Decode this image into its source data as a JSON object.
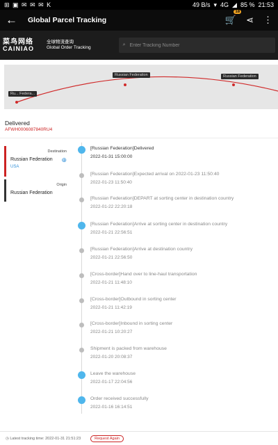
{
  "status_bar": {
    "left_icons": "⊞ ▣ ✉ ✉ ✉ K",
    "net_speed": "49 B/s",
    "signal": "4G",
    "battery": "85 %",
    "time": "21:53"
  },
  "app_bar": {
    "title": "Global Parcel Tracking",
    "cart_count": "18"
  },
  "brand": {
    "logo_cn": "菜鸟网络",
    "logo_en": "CAINIAO",
    "sub_cn": "全球物流查询",
    "sub_en": "Global Order Tracking",
    "search_placeholder": "Enter Tracking Number"
  },
  "map": {
    "label_origin": "Ru... Federa...",
    "label_mid": "Russian Federation",
    "label_dest": "Russian Federation"
  },
  "shipment": {
    "status": "Delivered",
    "tracking_number": "AFWH0006087840RU4"
  },
  "destination_card": {
    "role": "Destination",
    "country": "Russian Federation",
    "sub": "USA"
  },
  "origin_card": {
    "role": "Origin",
    "country": "Russian Federation"
  },
  "events": [
    {
      "desc": "[Russian Federation]Delivered",
      "time": "2022-01-31 15:00:00"
    },
    {
      "desc": "[Russian Federation]Expected arrival on 2022-01-23 11:50:40",
      "time": "2022-01-23 11:50:40"
    },
    {
      "desc": "[Russian Federation]DEPART at sorting center in destination country",
      "time": "2022-01-22 22:20:18"
    },
    {
      "desc": "[Russian Federation]Arrive at sorting center in destination country",
      "time": "2022-01-21 22:56:51"
    },
    {
      "desc": "[Russian Federation]Arrive at destination country",
      "time": "2022-01-21 22:56:50"
    },
    {
      "desc": "[Cross-border]Hand over to line-haul transportation",
      "time": "2022-01-21 11:48:10"
    },
    {
      "desc": "[Cross-border]Outbound in sorting center",
      "time": "2022-01-21 11:42:19"
    },
    {
      "desc": "[Cross-border]Inbound in sorting center",
      "time": "2022-01-21 10:20:27"
    },
    {
      "desc": "Shipment is packed from warehouse",
      "time": "2022-01-20 20:08:37"
    },
    {
      "desc": "Leave the warehouse",
      "time": "2022-01-17 22:04:56"
    },
    {
      "desc": "Order received successfully",
      "time": "2022-01-16 16:14:51"
    }
  ],
  "footer": {
    "last_update": "Latest tracking time: 2022-01-31 21:51:23",
    "request_button": "Request Again"
  }
}
